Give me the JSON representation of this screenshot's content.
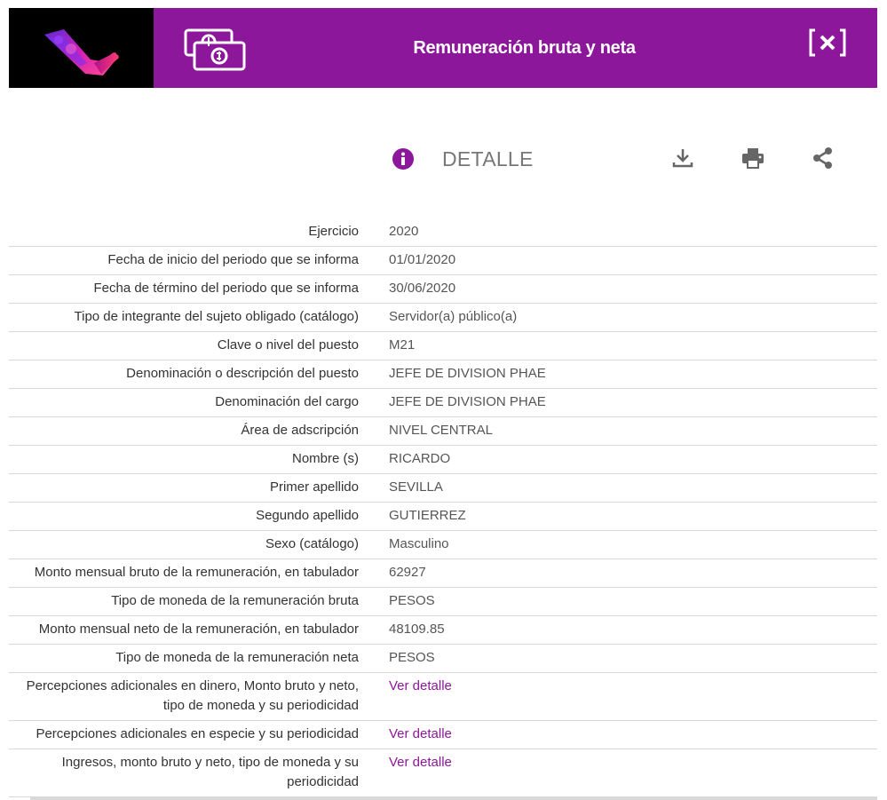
{
  "header": {
    "title": "Remuneración bruta y neta",
    "logo_icon": "brand-logo-icon",
    "section_icon": "money-bills-icon",
    "close_icon": "close-icon",
    "accent": "#8c179a"
  },
  "toolbar": {
    "label": "DETALLE",
    "icons": [
      "info-icon",
      "download-icon",
      "print-icon",
      "share-icon"
    ]
  },
  "rows": [
    {
      "label": "Ejercicio",
      "value": "2020"
    },
    {
      "label": "Fecha de inicio del periodo que se informa",
      "value": "01/01/2020"
    },
    {
      "label": "Fecha de término del periodo que se informa",
      "value": "30/06/2020"
    },
    {
      "label": "Tipo de integrante del sujeto obligado (catálogo)",
      "value": "Servidor(a) público(a)"
    },
    {
      "label": "Clave o nivel del puesto",
      "value": "M21"
    },
    {
      "label": "Denominación o descripción del puesto",
      "value": "JEFE DE DIVISION PHAE"
    },
    {
      "label": "Denominación del cargo",
      "value": "JEFE DE DIVISION PHAE"
    },
    {
      "label": "Área de adscripción",
      "value": "NIVEL CENTRAL"
    },
    {
      "label": "Nombre (s)",
      "value": "RICARDO"
    },
    {
      "label": "Primer apellido",
      "value": "SEVILLA"
    },
    {
      "label": "Segundo apellido",
      "value": "GUTIERREZ"
    },
    {
      "label": "Sexo (catálogo)",
      "value": "Masculino"
    },
    {
      "label": "Monto mensual bruto de la remuneración, en tabulador",
      "value": "62927"
    },
    {
      "label": "Tipo de moneda de la remuneración bruta",
      "value": "PESOS"
    },
    {
      "label": "Monto mensual neto de la remuneración, en tabulador",
      "value": "48109.85"
    },
    {
      "label": "Tipo de moneda de la remuneración neta",
      "value": "PESOS"
    },
    {
      "label": "Percepciones adicionales en dinero, Monto bruto y neto, tipo de moneda y su periodicidad",
      "value": "Ver detalle",
      "link": true
    },
    {
      "label": "Percepciones adicionales en especie y su periodicidad",
      "value": "Ver detalle",
      "link": true
    },
    {
      "label": "Ingresos, monto bruto y neto, tipo de moneda y su periodicidad",
      "value": "Ver detalle",
      "link": true
    }
  ]
}
